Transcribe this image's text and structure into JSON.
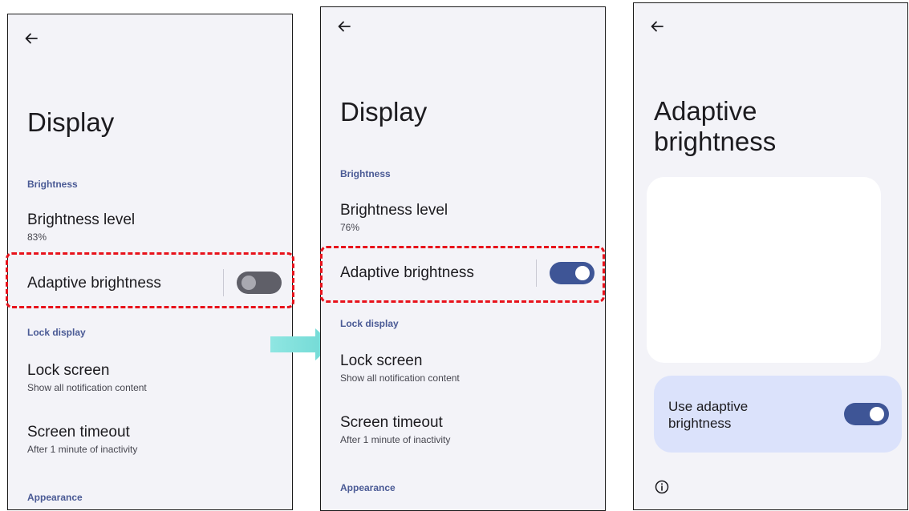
{
  "screen_before": {
    "title": "Display",
    "sections": {
      "brightness_header": "Brightness",
      "brightness_level": {
        "title": "Brightness level",
        "summary": "83%"
      },
      "adaptive_brightness": {
        "title": "Adaptive brightness",
        "switch_on": false
      },
      "lock_display_header": "Lock display",
      "lock_screen": {
        "title": "Lock screen",
        "summary": "Show all notification content"
      },
      "screen_timeout": {
        "title": "Screen timeout",
        "summary": "After 1 minute of inactivity"
      },
      "appearance_header": "Appearance"
    }
  },
  "screen_after": {
    "title": "Display",
    "sections": {
      "brightness_header": "Brightness",
      "brightness_level": {
        "title": "Brightness level",
        "summary": "76%"
      },
      "adaptive_brightness": {
        "title": "Adaptive brightness",
        "switch_on": true
      },
      "lock_display_header": "Lock display",
      "lock_screen": {
        "title": "Lock screen",
        "summary": "Show all notification content"
      },
      "screen_timeout": {
        "title": "Screen timeout",
        "summary": "After 1 minute of inactivity"
      },
      "appearance_header": "Appearance"
    }
  },
  "screen_adaptive": {
    "title_line1": "Adaptive",
    "title_line2": "brightness",
    "use_adaptive_label": "Use adaptive brightness",
    "use_adaptive_switch_on": true
  },
  "icons": {
    "back": "back-arrow-icon",
    "info": "info-icon",
    "transition_arrow": "arrow-right-icon"
  },
  "colors": {
    "screen_bg": "#f3f3f8",
    "accent": "#3e5596",
    "section_header": "#4a5a95",
    "switch_off": "#5f5f68",
    "highlight": "#e8121b",
    "arrow": "#7fe0dc",
    "toggle_card": "#dbe2fb"
  }
}
